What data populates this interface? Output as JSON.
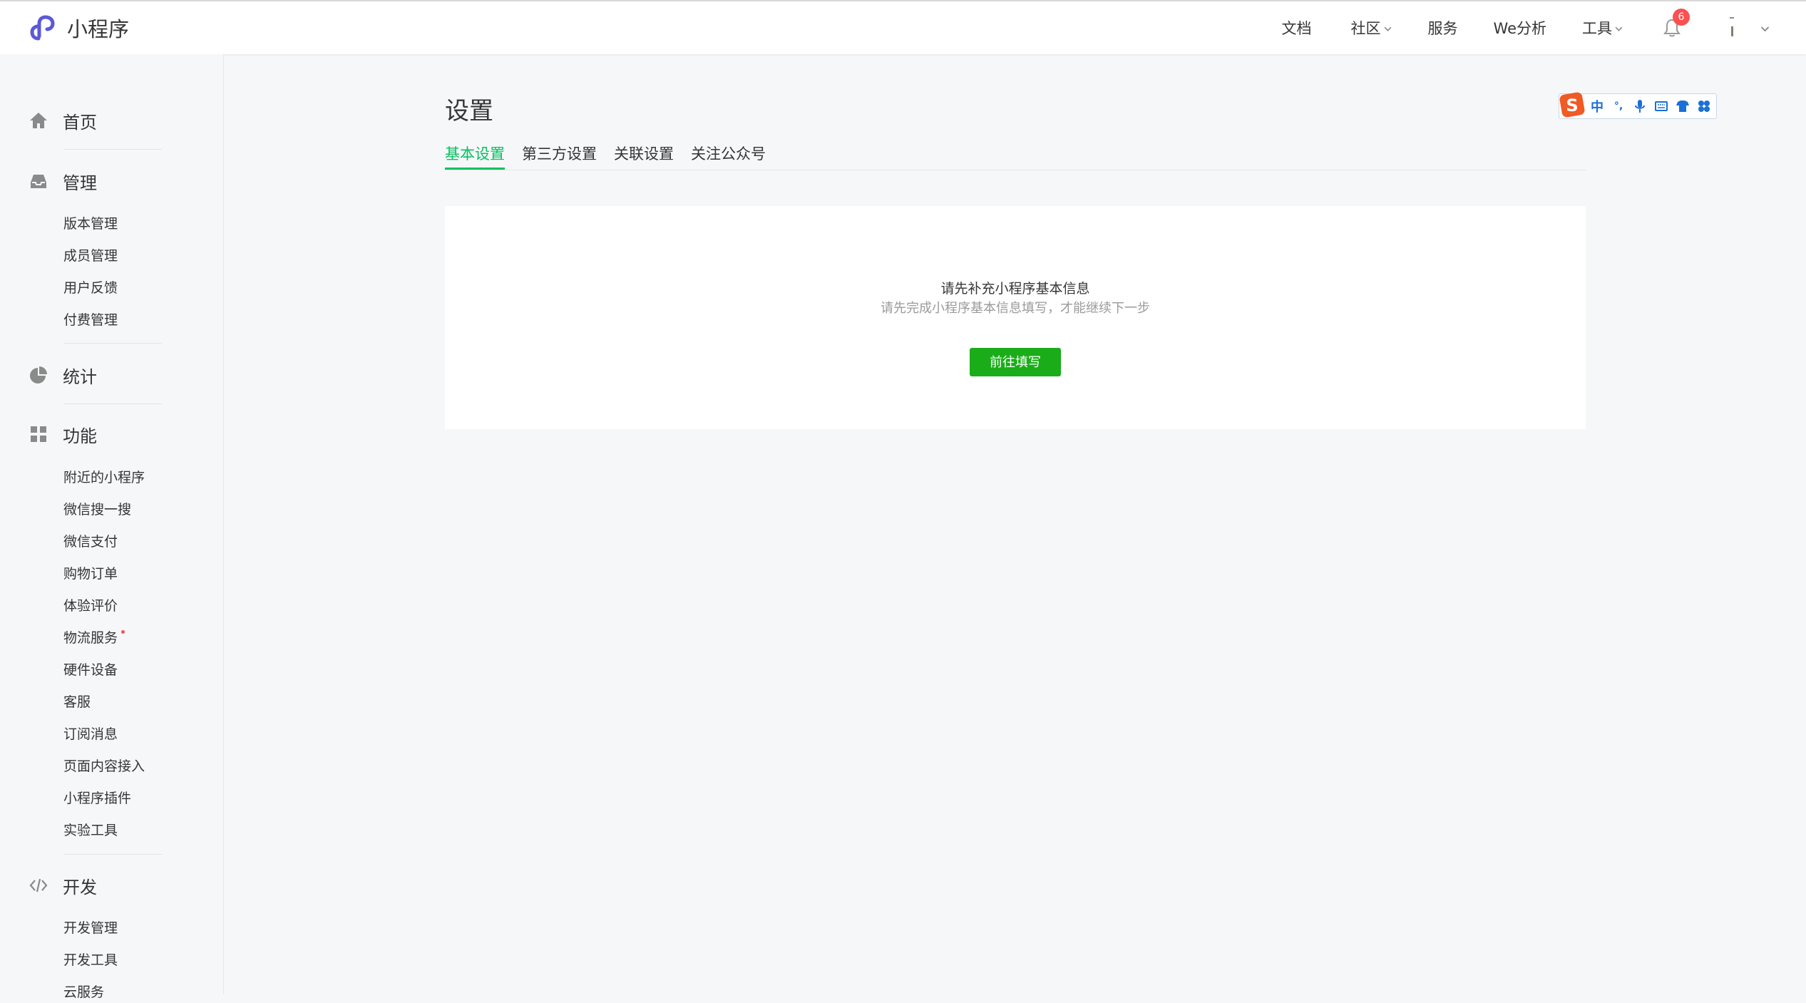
{
  "header": {
    "logo_text": "小程序",
    "nav": [
      {
        "label": "文档"
      },
      {
        "label": "社区"
      },
      {
        "label": "服务"
      },
      {
        "label": "We分析"
      },
      {
        "label": "工具"
      }
    ],
    "notification_count": "6"
  },
  "sidebar": {
    "sections": [
      {
        "label": "首页",
        "icon": "home-icon"
      },
      {
        "label": "管理",
        "icon": "inbox-icon",
        "items": [
          "版本管理",
          "成员管理",
          "用户反馈",
          "付费管理"
        ]
      },
      {
        "label": "统计",
        "icon": "pie-chart-icon"
      },
      {
        "label": "功能",
        "icon": "grid-icon",
        "items": [
          "附近的小程序",
          "微信搜一搜",
          "微信支付",
          "购物订单",
          "体验评价",
          "物流服务",
          "硬件设备",
          "客服",
          "订阅消息",
          "页面内容接入",
          "小程序插件",
          "实验工具"
        ]
      },
      {
        "label": "开发",
        "icon": "code-icon",
        "items": [
          "开发管理",
          "开发工具",
          "云服务"
        ]
      }
    ]
  },
  "main": {
    "title": "设置",
    "tabs": [
      {
        "label": "基本设置",
        "active": true
      },
      {
        "label": "第三方设置"
      },
      {
        "label": "关联设置"
      },
      {
        "label": "关注公众号"
      }
    ],
    "card": {
      "title": "请先补充小程序基本信息",
      "description": "请先完成小程序基本信息填写，才能继续下一步",
      "button_label": "前往填写"
    }
  },
  "ime_toolbar": {
    "mode": "中",
    "punct": "°,"
  },
  "colors": {
    "accent": "#07c160",
    "button": "#1aad19",
    "badge": "#fa5151",
    "logo": "#5b59d8"
  }
}
